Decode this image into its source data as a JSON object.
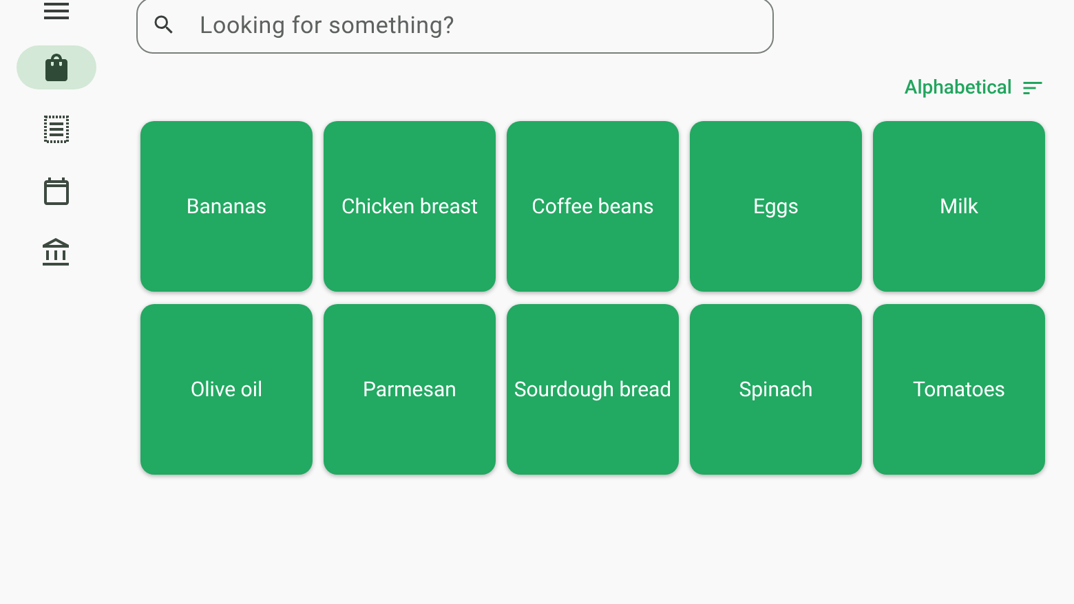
{
  "nav": [
    {
      "kind": "bag",
      "selected": true
    },
    {
      "kind": "receipt",
      "selected": false
    },
    {
      "kind": "calendar",
      "selected": false
    },
    {
      "kind": "bank",
      "selected": false
    }
  ],
  "search": {
    "placeholder": "Looking for something?"
  },
  "sort": {
    "label": "Alphabetical"
  },
  "items": [
    "Bananas",
    "Chicken breast",
    "Coffee beans",
    "Eggs",
    "Milk",
    "Olive oil",
    "Parmesan",
    "Sourdough bread",
    "Spinach",
    "Tomatoes"
  ]
}
